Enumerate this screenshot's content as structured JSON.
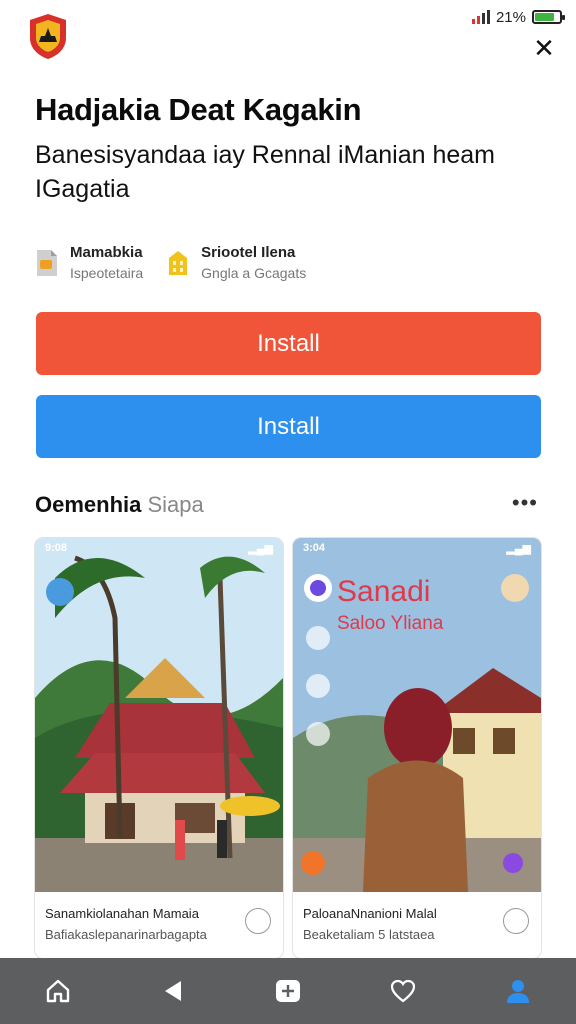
{
  "status_bar": {
    "battery_text": "21%",
    "battery_level": 0.8
  },
  "header": {
    "title": "Hadjakia Deat Kagakin",
    "subtitle": "Banesisyandaa iay Rennal iManian heam IGagatia"
  },
  "meta": [
    {
      "title": "Mamabkia",
      "sub": "Ispeotetaira",
      "icon": "file-icon"
    },
    {
      "title": "Sriootel Ilena",
      "sub": "Gngla a Gcagats",
      "icon": "building-icon"
    }
  ],
  "buttons": {
    "install_primary": "Install",
    "install_secondary": "Install"
  },
  "section": {
    "title_bold": "Oemenhia",
    "title_light": "Siapa",
    "more": "•••"
  },
  "cards": [
    {
      "mini_status_left": "9:08",
      "caption_title": "Sanamkiolanahan Mamaia",
      "caption_sub": "Bafiakaslepanarinarbagapta"
    },
    {
      "mini_status_left": "3:04",
      "overlay_title": "Sanadi",
      "overlay_sub": "Saloo Yliana",
      "caption_title": "PaloanaNnanioni Malal",
      "caption_sub": "Beaketaliam 5 latstaea"
    }
  ],
  "nav": [
    "home-icon",
    "back-icon",
    "add-icon",
    "heart-icon",
    "profile-icon"
  ],
  "colors": {
    "install_orange": "#f0553a",
    "install_blue": "#2d8fee",
    "nav_bg": "#5d5e60",
    "active": "#2d8fee"
  }
}
